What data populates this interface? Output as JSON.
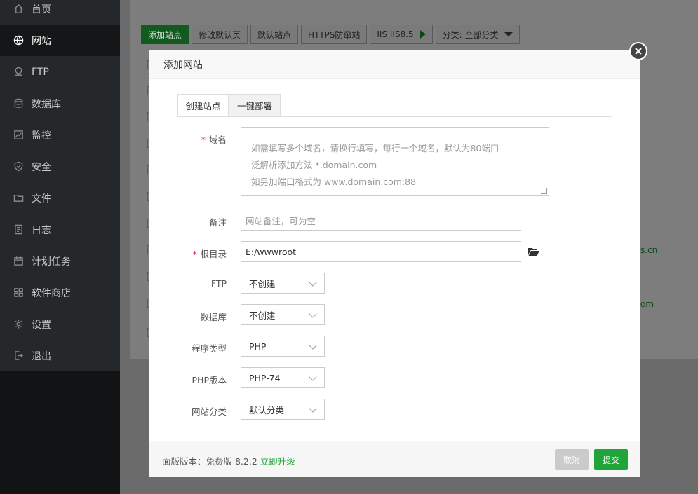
{
  "sidebar": {
    "items": [
      {
        "label": "首页",
        "icon": "home-icon"
      },
      {
        "label": "网站",
        "icon": "globe-icon",
        "active": true
      },
      {
        "label": "FTP",
        "icon": "ftp-icon"
      },
      {
        "label": "数据库",
        "icon": "database-icon"
      },
      {
        "label": "监控",
        "icon": "monitor-icon"
      },
      {
        "label": "安全",
        "icon": "shield-icon"
      },
      {
        "label": "文件",
        "icon": "folder-icon"
      },
      {
        "label": "日志",
        "icon": "log-icon"
      },
      {
        "label": "计划任务",
        "icon": "calendar-icon"
      },
      {
        "label": "软件商店",
        "icon": "apps-icon"
      },
      {
        "label": "设置",
        "icon": "gear-icon"
      },
      {
        "label": "退出",
        "icon": "logout-icon"
      }
    ]
  },
  "toolbar": {
    "add_site": "添加站点",
    "edit_default": "修改默认页",
    "default_site": "默认站点",
    "https_guard": "HTTPS防窜站",
    "iis_label": "IIS IIS8.5",
    "category": "分类: 全部分类"
  },
  "background": {
    "link1": "s.cn",
    "link2": "om"
  },
  "modal": {
    "title": "添加网站",
    "tabs": [
      "创建站点",
      "一键部署"
    ],
    "domain": {
      "label": "域名",
      "placeholder_lines": [
        "如需填写多个域名，请换行填写，每行一个域名，默认为80端口",
        "泛解析添加方法 *.domain.com",
        "如另加端口格式为 www.domain.com:88"
      ]
    },
    "remark": {
      "label": "备注",
      "placeholder": "网站备注，可为空"
    },
    "root": {
      "label": "根目录",
      "value": "E:/wwwroot"
    },
    "ftp": {
      "label": "FTP",
      "value": "不创建"
    },
    "database": {
      "label": "数据库",
      "value": "不创建"
    },
    "program": {
      "label": "程序类型",
      "value": "PHP"
    },
    "php_version": {
      "label": "PHP版本",
      "value": "PHP-74"
    },
    "site_category": {
      "label": "网站分类",
      "value": "默认分类"
    },
    "footer": {
      "version_text": "面版版本：免费版 8.2.2",
      "upgrade": "立即升级",
      "cancel": "取消",
      "submit": "提交"
    }
  },
  "colors": {
    "accent": "#20a53a",
    "sidebar": "#24282b",
    "required": "#ee1144"
  }
}
